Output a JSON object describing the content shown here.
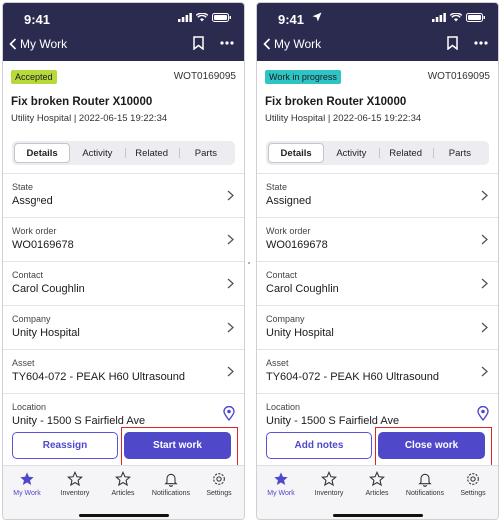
{
  "left": {
    "time": "9:41",
    "nav": {
      "back_label": "My Work"
    },
    "status_badge": "Accepted",
    "work_order_id": "WOT0169095",
    "title": "Fix broken Router X10000",
    "subtitle": "Utility Hospital | 2022-06-15  19:22:34",
    "tabs": [
      {
        "label": "Details"
      },
      {
        "label": "Activity"
      },
      {
        "label": "Related"
      },
      {
        "label": "Parts"
      }
    ],
    "fields": [
      {
        "label": "State",
        "value": "Assgⁿed"
      },
      {
        "label": "Work order",
        "value": "WO0169678"
      },
      {
        "label": "Contact",
        "value": "Carol Coughlin"
      },
      {
        "label": "Company",
        "value": "Unity Hospital"
      },
      {
        "label": "Asset",
        "value": "TY604-072 - PEAK H60 Ultrasound"
      },
      {
        "label": "Location",
        "value": "Unity - 1500 S Fairfield Ave"
      }
    ],
    "actions": {
      "secondary": "Reassign",
      "primary": "Start work"
    }
  },
  "right": {
    "time": "9:41",
    "nav": {
      "back_label": "My Work"
    },
    "status_badge": "Work in progress",
    "work_order_id": "WOT0169095",
    "title": "Fix broken Router X10000",
    "subtitle": "Utility Hospital | 2022-06-15  19:22:34",
    "tabs": [
      {
        "label": "Details"
      },
      {
        "label": "Activity"
      },
      {
        "label": "Related"
      },
      {
        "label": "Parts"
      }
    ],
    "fields": [
      {
        "label": "State",
        "value": "Assigned"
      },
      {
        "label": "Work order",
        "value": "WO0169678"
      },
      {
        "label": "Contact",
        "value": "Carol Coughlin"
      },
      {
        "label": "Company",
        "value": "Unity Hospital"
      },
      {
        "label": "Asset",
        "value": "TY604-072 - PEAK H60 Ultrasound"
      },
      {
        "label": "Location",
        "value": "Unity - 1500 S Fairfield Ave"
      }
    ],
    "actions": {
      "secondary": "Add notes",
      "primary": "Close work"
    }
  },
  "tabbar": [
    {
      "label": "My Work",
      "icon": "star-filled-icon",
      "active": true
    },
    {
      "label": "Inventory",
      "icon": "star-outline-icon",
      "active": false
    },
    {
      "label": "Articles",
      "icon": "star-outline-icon",
      "active": false
    },
    {
      "label": "Notifications",
      "icon": "bell-icon",
      "active": false
    },
    {
      "label": "Settings",
      "icon": "gear-icon",
      "active": false
    }
  ],
  "colors": {
    "header_bg": "#2b2b4f",
    "accent": "#4f48c9",
    "accepted_badge": "#b7d93a",
    "progress_badge": "#2ec4c4",
    "highlight_box": "#e02424"
  }
}
